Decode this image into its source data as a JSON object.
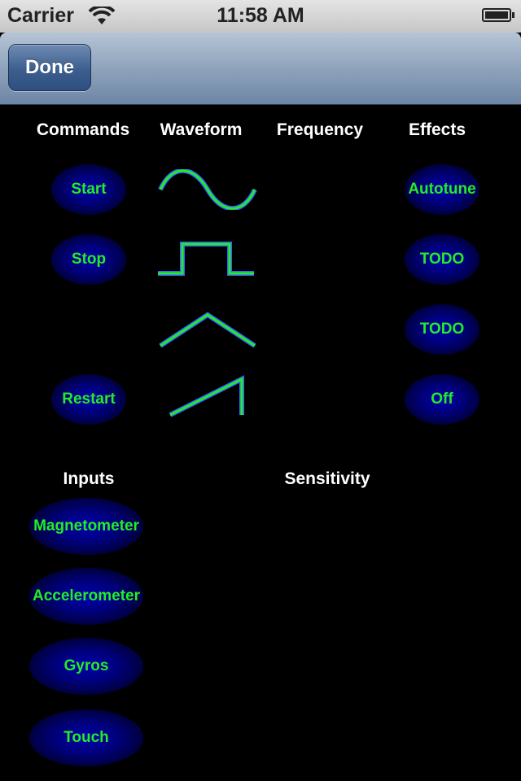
{
  "status_bar": {
    "carrier": "Carrier",
    "time": "11:58 AM",
    "wifi_icon": "wifi-icon",
    "battery_icon": "battery-icon"
  },
  "nav_bar": {
    "done_label": "Done"
  },
  "columns": {
    "commands": "Commands",
    "waveform": "Waveform",
    "frequency": "Frequency",
    "effects": "Effects"
  },
  "commands": {
    "start": "Start",
    "stop": "Stop",
    "restart": "Restart"
  },
  "waveforms": [
    "sine-wave-icon",
    "square-wave-icon",
    "triangle-wave-icon",
    "sawtooth-wave-icon"
  ],
  "effects": {
    "autotune": "Autotune",
    "todo1": "TODO",
    "todo2": "TODO",
    "off": "Off"
  },
  "sections": {
    "inputs": "Inputs",
    "sensitivity": "Sensitivity"
  },
  "inputs": {
    "magnetometer": "Magnetometer",
    "accelerometer": "Accelerometer",
    "gyros": "Gyros",
    "touch": "Touch"
  },
  "colors": {
    "accent_green": "#22ee22",
    "glow_blue": "#0000b0",
    "wave_outline": "#3a64ff"
  }
}
